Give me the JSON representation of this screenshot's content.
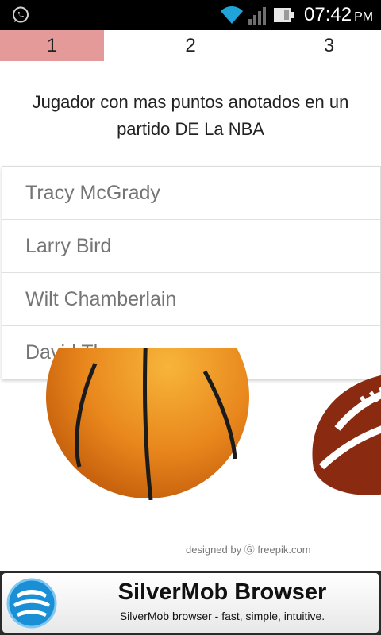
{
  "status_bar": {
    "time": "07:42",
    "ampm": "PM",
    "icons": [
      "whatsapp-icon",
      "wifi-icon",
      "signal-icon",
      "battery-icon"
    ]
  },
  "tabs": [
    {
      "label": "1",
      "active": true
    },
    {
      "label": "2",
      "active": false
    },
    {
      "label": "3",
      "active": false
    }
  ],
  "question": "Jugador con mas puntos anotados en un partido DE La NBA",
  "answers": [
    "Tracy McGrady",
    "Larry Bird",
    "Wilt Chamberlain",
    "David Thompson"
  ],
  "image_credit": "designed by Ⓖ freepik.com",
  "ad": {
    "title": "SilverMob Browser",
    "subtitle": "SilverMob browser - fast, simple, intuitive."
  },
  "colors": {
    "active_tab": "#e59a9a",
    "status_bar": "#000000",
    "answer_text": "#757575",
    "ad_logo": "#1a8fd6"
  }
}
